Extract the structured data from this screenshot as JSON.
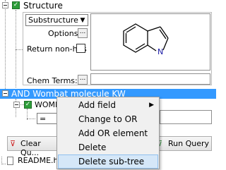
{
  "tree": {
    "structure_label": "Structure",
    "and_node_label": "AND Wombat molecule KW",
    "child_label": "WOMB"
  },
  "structure_panel": {
    "search_type": "Substructure",
    "options_label": "Options:",
    "return_nonhits_label": "Return non-hits",
    "chem_terms_label": "Chem Terms:",
    "dots": "...",
    "atom_label": "N"
  },
  "condition": {
    "operator": "="
  },
  "toolbar": {
    "clear_label": "Clear Qu...",
    "run_label": "Run Query"
  },
  "file": {
    "name": "README.ht"
  },
  "context_menu": {
    "items": [
      {
        "label": "Add field",
        "has_submenu": true
      },
      {
        "label": "Change to OR"
      },
      {
        "label": "Add OR element"
      },
      {
        "label": "Delete"
      },
      {
        "label": "Delete sub-tree",
        "highlighted": true
      }
    ],
    "submenu_arrow": "▶"
  },
  "colors": {
    "selection": "#3399ff",
    "check_green": "#2e9d3a",
    "menu_highlight": "#d5e7f8"
  }
}
